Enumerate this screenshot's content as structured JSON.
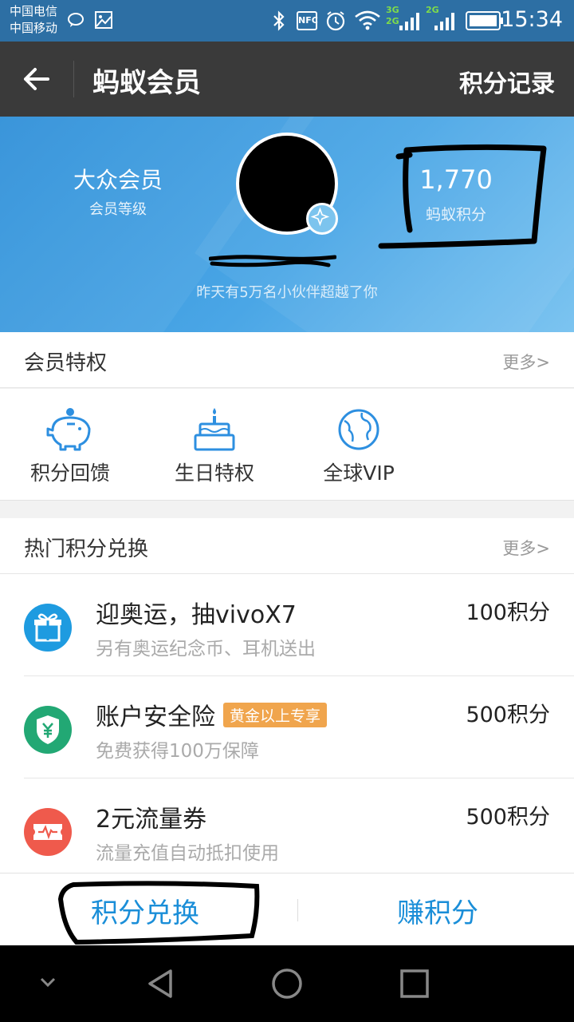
{
  "status_bar": {
    "carrier_1": "中国电信",
    "carrier_2": "中国移动",
    "nfc": "NFC",
    "net_3g": "3G",
    "net_2g_a": "2G",
    "net_2g_b": "2G",
    "time": "15:34"
  },
  "app_bar": {
    "title": "蚂蚁会员",
    "record_label": "积分记录"
  },
  "member": {
    "level_name": "大众会员",
    "level_label": "会员等级",
    "points": "1,770",
    "points_label": "蚂蚁积分",
    "overtake_text": "昨天有5万名小伙伴超越了你"
  },
  "privileges": {
    "heading": "会员特权",
    "more": "更多>",
    "items": [
      {
        "label": "积分回馈",
        "icon": "piggy-bank-icon"
      },
      {
        "label": "生日特权",
        "icon": "birthday-cake-icon"
      },
      {
        "label": "全球VIP",
        "icon": "globe-icon"
      }
    ]
  },
  "exchange": {
    "heading": "热门积分兑换",
    "more": "更多>",
    "items": [
      {
        "title": "迎奥运，抽vivoX7",
        "subtitle": "另有奥运纪念币、耳机送出",
        "points": "100积分",
        "icon": "gift-icon",
        "color": "#1e9be0"
      },
      {
        "title": "账户安全险",
        "tag": "黄金以上专享",
        "subtitle": "免费获得100万保障",
        "points": "500积分",
        "icon": "shield-yuan-icon",
        "color": "#22a874"
      },
      {
        "title": "2元流量券",
        "subtitle": "流量充值自动抵扣使用",
        "points": "500积分",
        "icon": "data-coupon-icon",
        "color": "#ef5a4c"
      }
    ]
  },
  "tabs": {
    "exchange_label": "积分兑换",
    "earn_label": "赚积分"
  },
  "colors": {
    "accent": "#1a8ed8",
    "status_bar": "#2d6fa4",
    "app_bar": "#3a3a3a",
    "tag": "#f0a54d"
  }
}
